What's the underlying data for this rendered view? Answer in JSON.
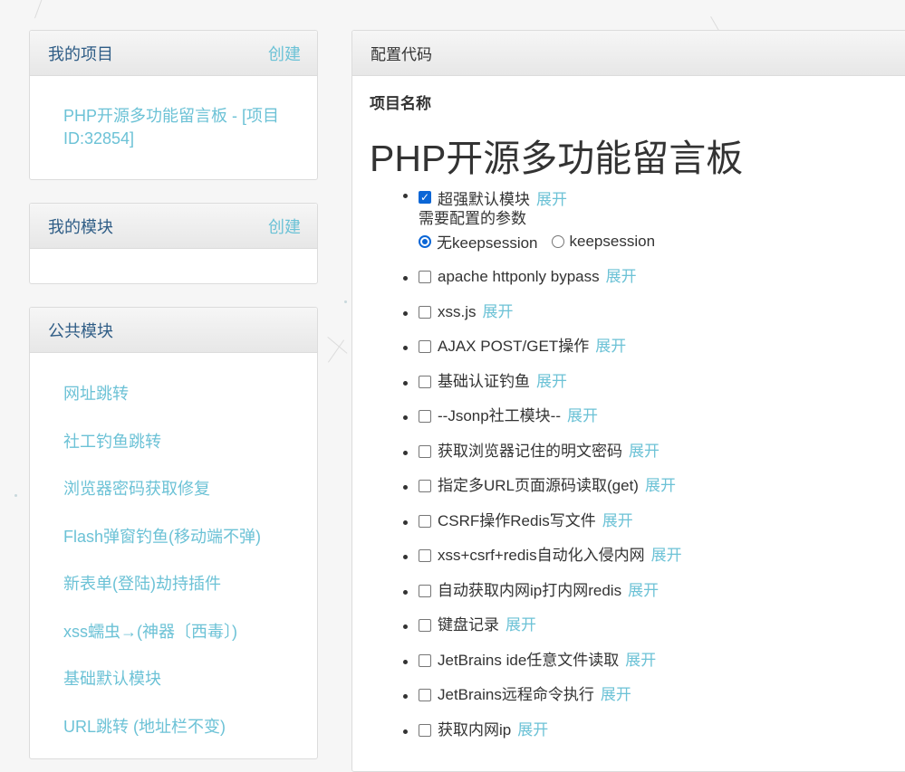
{
  "my_projects": {
    "title": "我的项目",
    "create_label": "创建",
    "items": [
      "PHP开源多功能留言板 - [项目ID:32854]"
    ]
  },
  "my_modules": {
    "title": "我的模块",
    "create_label": "创建"
  },
  "public_modules": {
    "title": "公共模块",
    "items": [
      "网址跳转",
      "社工钓鱼跳转",
      "浏览器密码获取修复",
      "Flash弹窗钓鱼(移动端不弹)",
      "新表单(登陆)劫持插件",
      "xss蠕虫→(神器〔西毒〕)",
      "基础默认模块",
      "URL跳转 (地址栏不变)"
    ]
  },
  "config": {
    "header": "配置代码",
    "project_name_label": "项目名称",
    "project_title": "PHP开源多功能留言板",
    "expand_label": "展开",
    "first_module": {
      "label": "超强默认模块",
      "checked": true,
      "params_label": "需要配置的参数",
      "radio_options": [
        "无keepsession",
        "keepsession"
      ],
      "selected_radio": "无keepsession"
    },
    "modules": [
      "apache httponly bypass",
      "xss.js",
      "AJAX POST/GET操作",
      "基础认证钓鱼",
      "--Jsonp社工模块--",
      "获取浏览器记住的明文密码",
      "指定多URL页面源码读取(get)",
      "CSRF操作Redis写文件",
      "xss+csrf+redis自动化入侵内网",
      "自动获取内网ip打内网redis",
      "键盘记录",
      "JetBrains ide任意文件读取",
      "JetBrains远程命令执行",
      "获取内网ip"
    ]
  },
  "colors": {
    "link": "#6cc2d6",
    "panel_title": "#2f5d86",
    "checkbox_accent": "#0b66d6"
  }
}
